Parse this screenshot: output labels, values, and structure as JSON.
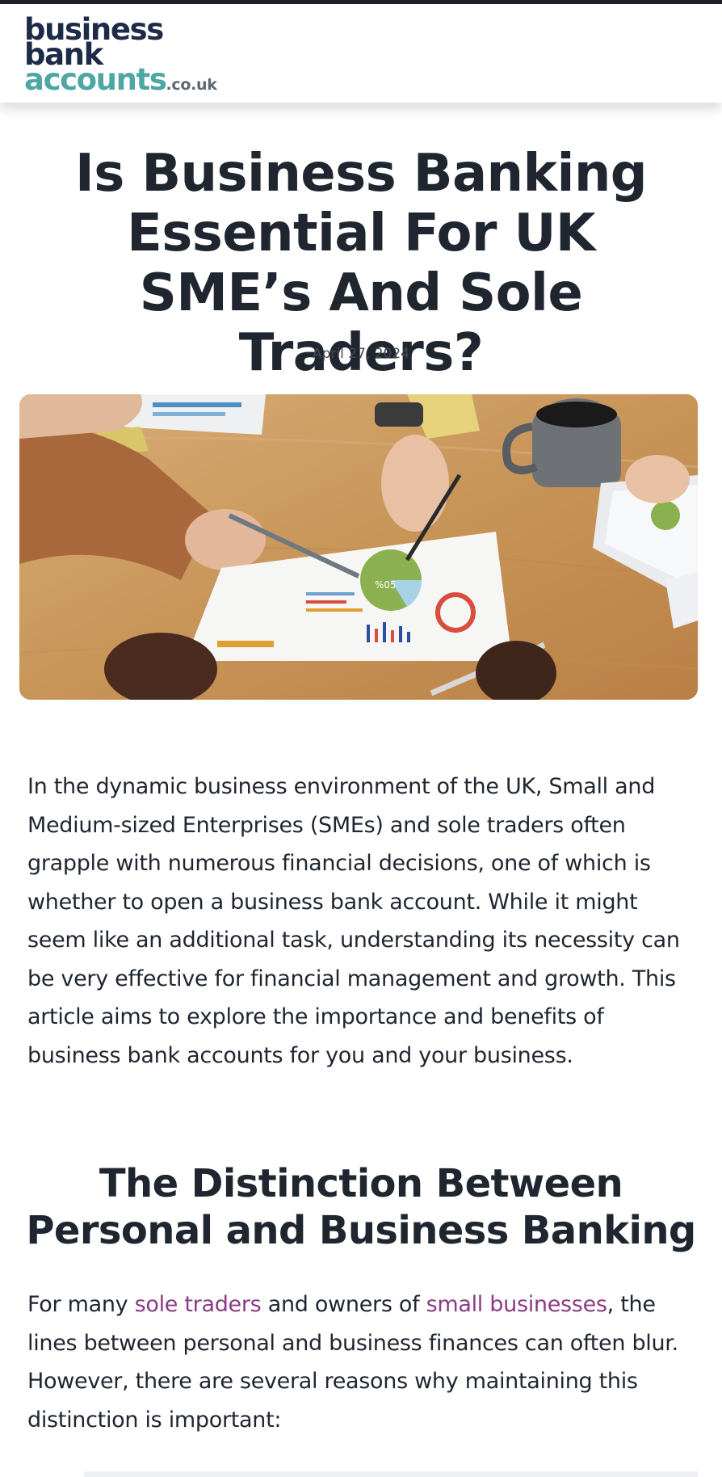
{
  "header": {
    "logo": {
      "line1": "business",
      "line2": "bank",
      "line3": "accounts",
      "tld": ".co.uk"
    }
  },
  "article": {
    "title": "Is Business Banking Essential For UK SME’s And Sole Traders?",
    "date": "April 27, 2024",
    "hero_image": "business team analysing printed charts and graphs on a wooden table with coffee mug and tablet",
    "hero_pie_label": "%05",
    "intro": "In the dynamic business environment of the UK, Small and Medium-sized Enterprises (SMEs) and sole traders often grapple with numerous financial decisions, one of which is whether to open a business bank account. While it might seem like an additional task, understanding its necessity can be very effective for financial management and growth. This article aims to explore the importance and benefits of business bank accounts for you and your business.",
    "section1": {
      "heading": "The Distinction Between Personal and Business Banking",
      "para_before_link1": "For many ",
      "link1": "sole traders",
      "para_between": " and owners of ",
      "link2": "small businesses",
      "para_after": ", the lines between personal and business finances can often blur. However, there are several reasons why maintaining this distinction is important:"
    }
  },
  "colors": {
    "logo_navy": "#1e2b48",
    "logo_teal": "#4ea7a3",
    "link": "#8a3b86",
    "text": "#1f2630"
  }
}
